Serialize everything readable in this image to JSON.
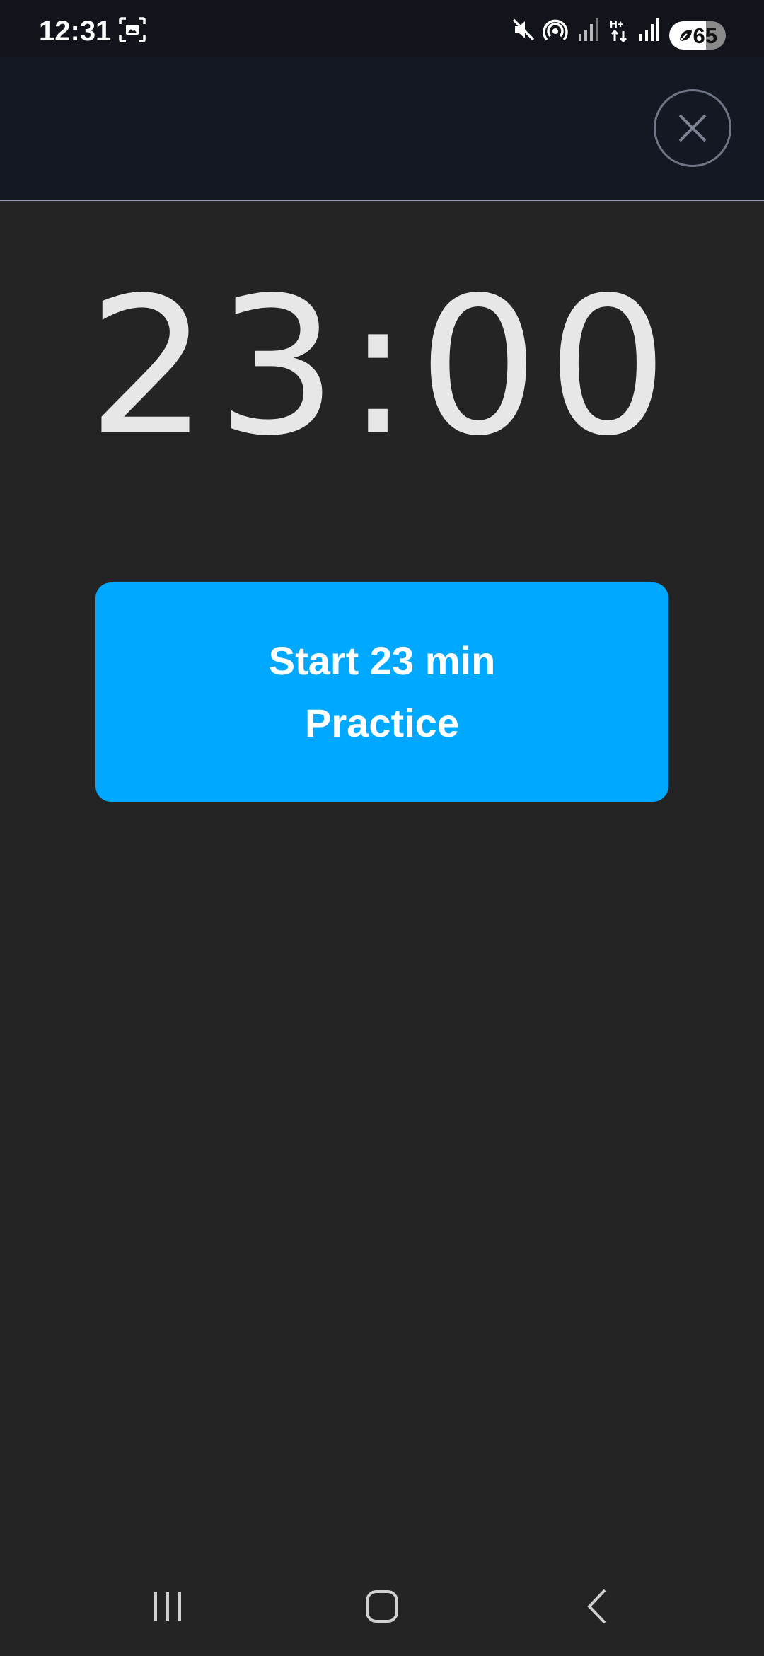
{
  "status_bar": {
    "time": "12:31",
    "battery_level": "65",
    "icons": [
      "screenshot-icon",
      "mute-icon",
      "hotspot-icon",
      "signal-icon",
      "hplus-data-icon",
      "signal-icon",
      "battery-icon"
    ]
  },
  "header": {
    "close_icon": "close-icon"
  },
  "timer": {
    "display": "23:00"
  },
  "start_button": {
    "label": "Start 23 min Practice"
  },
  "nav_bar": {
    "icons": [
      "recent-apps-icon",
      "home-icon",
      "back-icon"
    ]
  },
  "colors": {
    "background": "#242424",
    "header": "#141823",
    "accent": "#00a8ff",
    "timer_text": "#e7e7e7"
  }
}
